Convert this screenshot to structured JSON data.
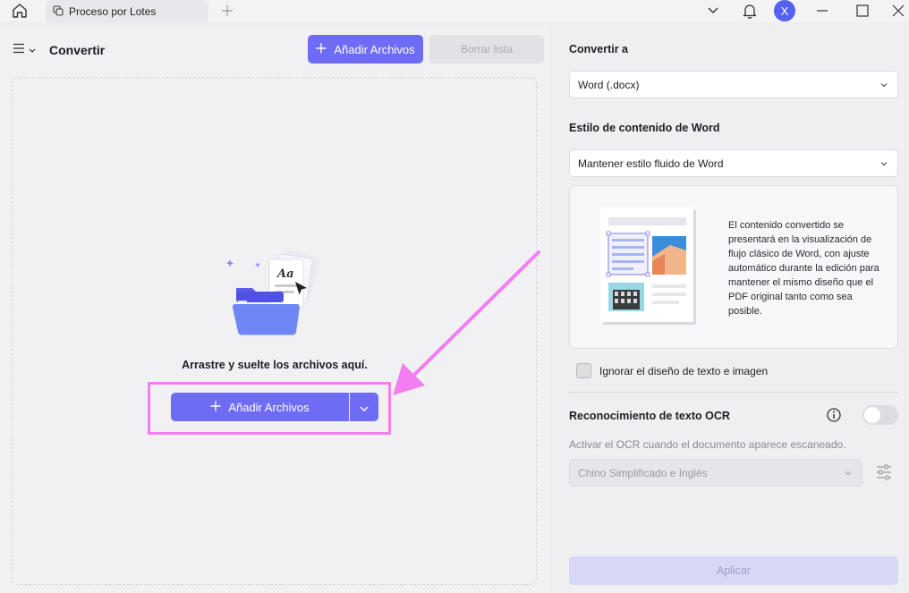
{
  "tab": {
    "label": "Proceso por Lotes"
  },
  "user": {
    "initial": "X"
  },
  "left": {
    "title": "Convertir",
    "add_files_label": "Añadir Archivos",
    "clear_list_label": "Borrar lista",
    "drop_text": "Arrastre y suelte los archivos aquí.",
    "add_files_main_label": "Añadir Archivos"
  },
  "right": {
    "convert_to_label": "Convertir a",
    "convert_to_value": "Word (.docx)",
    "style_label": "Estilo de contenido de Word",
    "style_value": "Mantener estilo fluido de Word",
    "style_description": "El contenido convertido se presentará en la visualización de flujo clásico de Word, con ajuste automático durante la edición para mantener el mismo diseño que el PDF original tanto como sea posible.",
    "ignore_layout_label": "Ignorar el diseño de texto e imagen",
    "ocr_label": "Reconocimiento de texto OCR",
    "ocr_description": "Activar el OCR cuando el documento aparece escaneado.",
    "ocr_language_value": "Chino Simplificado e Inglés",
    "apply_label": "Aplicar"
  },
  "colors": {
    "accent": "#6e6cf5",
    "highlight": "#f27ef1",
    "avatar": "#5461f0"
  }
}
